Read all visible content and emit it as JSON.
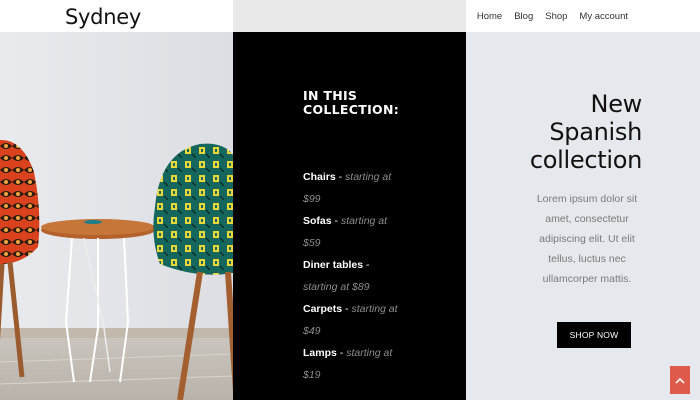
{
  "header": {
    "brand": "Sydney",
    "nav": [
      "Home",
      "Blog",
      "Shop",
      "My account"
    ]
  },
  "collection": {
    "title": "IN THIS COLLECTION:",
    "items": [
      {
        "name": "Chairs",
        "price": "starting at $99"
      },
      {
        "name": "Sofas",
        "price": "starting at $59"
      },
      {
        "name": "Diner tables",
        "price": "starting at $89"
      },
      {
        "name": "Carpets",
        "price": "starting at $49"
      },
      {
        "name": "Lamps",
        "price": "starting at $19"
      }
    ]
  },
  "promo": {
    "title_line1": "New",
    "title_line2": "Spanish",
    "title_line3": "collection",
    "body": "Lorem ipsum dolor sit amet, consectetur adipiscing elit. Ut elit tellus, luctus nec ullamcorper mattis.",
    "button": "SHOP NOW"
  },
  "icons": {
    "scroll_top": "chevron-up-icon",
    "photo": "chairs-photo"
  },
  "colors": {
    "dark_panel": "#000000",
    "promo_panel": "#e5e8ec",
    "price_text": "#8d8d8d",
    "scroll_top": "#e05a4c"
  }
}
